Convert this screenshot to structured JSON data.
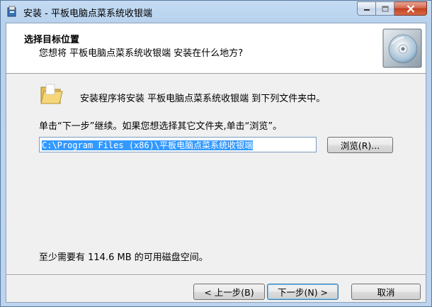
{
  "window": {
    "title": "安装 - 平板电脑点菜系统收银端"
  },
  "header": {
    "title": "选择目标位置",
    "subtitle": "您想将 平板电脑点菜系统收银端 安装在什么地方?"
  },
  "body": {
    "install_to_text": "安装程序将安装 平板电脑点菜系统收银端 到下列文件夹中。",
    "instruction_text": "单击“下一步”继续。如果您想选择其它文件夹,单击“浏览”。",
    "install_path": "C:\\Program Files (x86)\\平板电脑点菜系统收银端",
    "browse_label": "浏览(R)...",
    "disk_space_text": "至少需要有 114.6 MB 的可用磁盘空间。"
  },
  "footer": {
    "back_label": "< 上一步(B)",
    "next_label": "下一步(N) >",
    "cancel_label": "取消"
  },
  "icons": {
    "app": "installer-icon",
    "header": "cd-disc-icon",
    "folder": "folder-icon"
  }
}
